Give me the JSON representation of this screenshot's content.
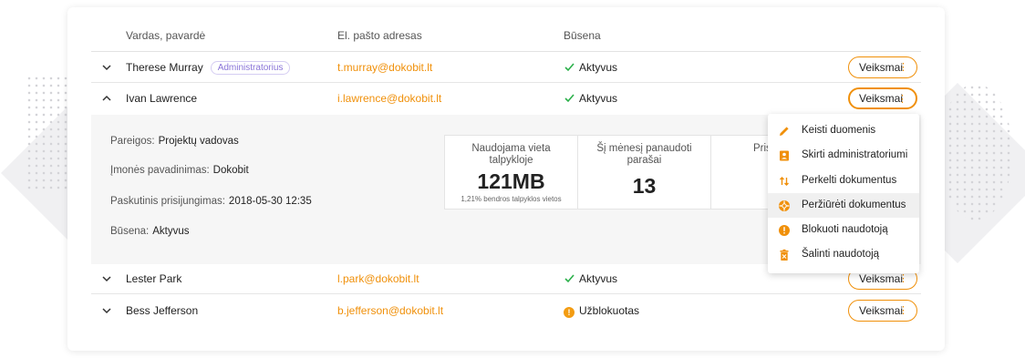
{
  "table": {
    "headers": {
      "name": "Vardas, pavardė",
      "email": "El. pašto adresas",
      "status": "Būsena"
    },
    "rows": [
      {
        "name": "Therese Murray",
        "badge": "Administratorius",
        "email": "t.murray@dokobit.lt",
        "status": "Aktyvus",
        "expanded": false,
        "action": "Veiksmai"
      },
      {
        "name": "Ivan Lawrence",
        "email": "i.lawrence@dokobit.lt",
        "status": "Aktyvus",
        "expanded": true,
        "action": "Veiksmai"
      },
      {
        "name": "Lester Park",
        "email": "l.park@dokobit.lt",
        "status": "Aktyvus",
        "expanded": false,
        "action": "Veiksmai"
      },
      {
        "name": "Bess Jefferson",
        "email": "b.jefferson@dokobit.lt",
        "status": "Užblokuotas",
        "expanded": false,
        "action": "Veiksmai"
      }
    ]
  },
  "details": {
    "position_label": "Pareigos:",
    "position_value": "Projektų vadovas",
    "company_label": "Įmonės pavadinimas:",
    "company_value": "Dokobit",
    "lastlogin_label": "Paskutinis prisijungimas:",
    "lastlogin_value": "2018-05-30 12:35",
    "status_label": "Būsena:",
    "status_value": "Aktyvus",
    "stats": [
      {
        "label": "Naudojama vieta talpykloje",
        "value": "121MB",
        "sub": "1,21% bendros talpyklos vietos"
      },
      {
        "label": "Šį mėnesį panaudoti parašai",
        "value": "13"
      },
      {
        "label": "Pris sesns"
      }
    ]
  },
  "actions_menu": {
    "items": [
      {
        "label": "Keisti duomenis",
        "icon": "pencil-icon"
      },
      {
        "label": "Skirti administratoriumi",
        "icon": "admin-badge-icon"
      },
      {
        "label": "Perkelti dokumentus",
        "icon": "transfer-arrows-icon"
      },
      {
        "label": "Peržiūrėti dokumentus",
        "icon": "view-documents-icon"
      },
      {
        "label": "Blokuoti naudotoją",
        "icon": "block-warning-icon"
      },
      {
        "label": "Šalinti naudotoją",
        "icon": "trash-icon"
      }
    ]
  },
  "colors": {
    "accent": "#f0900a",
    "success": "#2bb04a",
    "warning": "#f39c12",
    "badge": "#8a74d8"
  }
}
